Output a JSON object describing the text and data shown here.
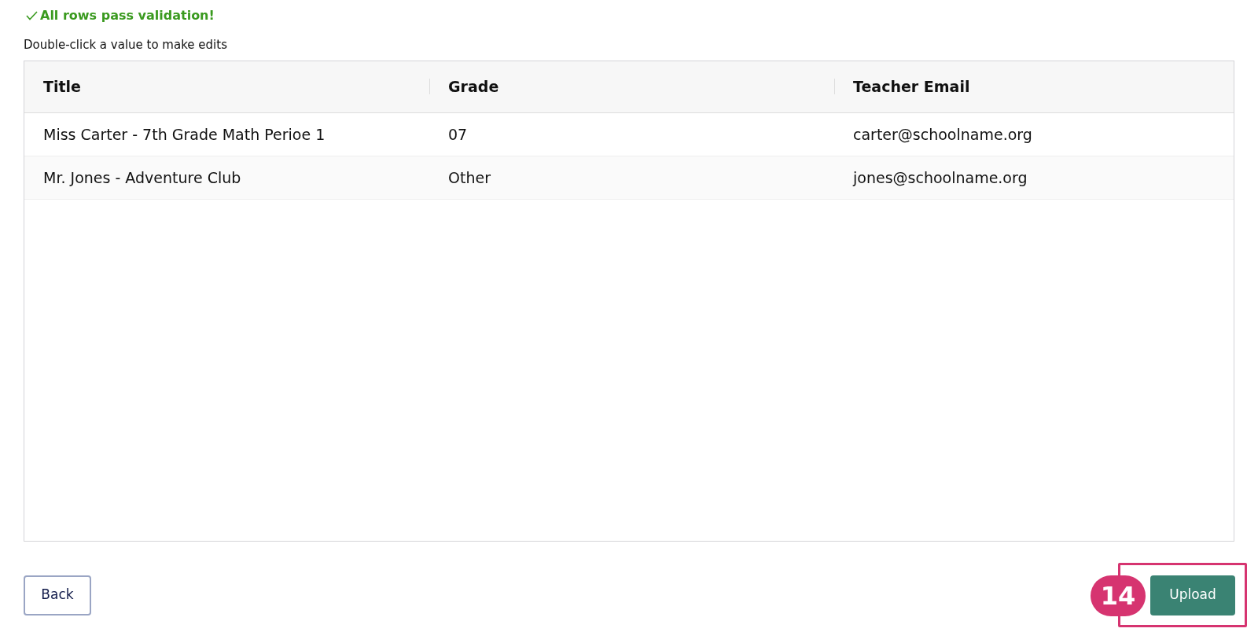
{
  "validation_message": "All rows pass validation!",
  "instruction": "Double-click a value to make edits",
  "table": {
    "columns": [
      "Title",
      "Grade",
      "Teacher Email"
    ],
    "rows": [
      [
        "Miss Carter - 7th Grade Math Perioe 1",
        "07",
        "carter@schoolname.org"
      ],
      [
        "Mr. Jones - Adventure Club",
        "Other",
        "jones@schoolname.org"
      ]
    ]
  },
  "buttons": {
    "back": "Back",
    "upload": "Upload"
  },
  "callout": {
    "number": "14"
  }
}
